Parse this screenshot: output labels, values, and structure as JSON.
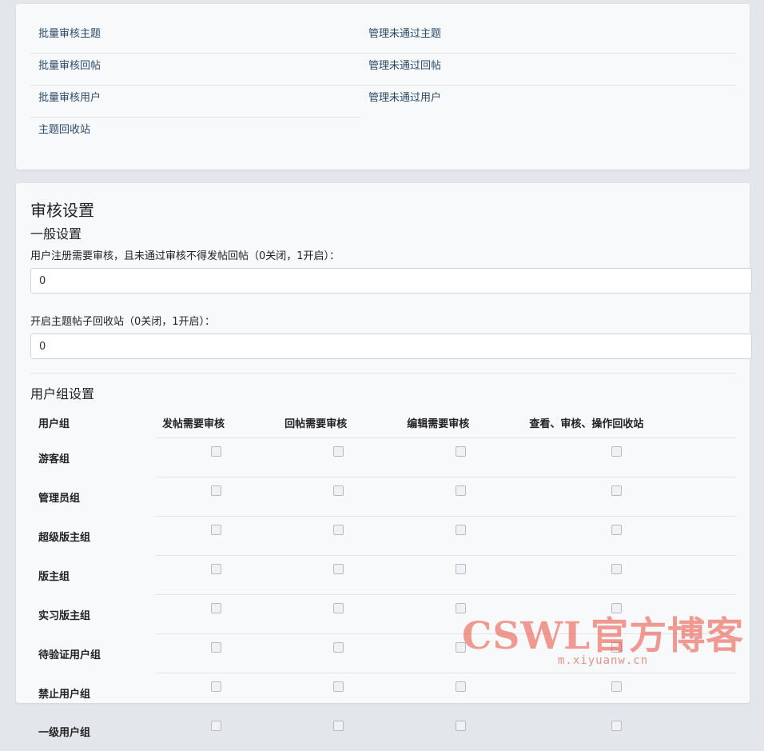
{
  "links": {
    "left": [
      "批量审核主题",
      "批量审核回帖",
      "批量审核用户",
      "主题回收站"
    ],
    "right": [
      "管理未通过主题",
      "管理未通过回帖",
      "管理未通过用户"
    ]
  },
  "settings": {
    "title": "审核设置",
    "general_title": "一般设置",
    "register_label": "用户注册需要审核，且未通过审核不得发帖回帖（0关闭，1开启）：",
    "register_value": "0",
    "recycle_label": "开启主题帖子回收站（0关闭，1开启）：",
    "recycle_value": "0"
  },
  "group_settings": {
    "title": "用户组设置",
    "columns": [
      "用户组",
      "发帖需要审核",
      "回帖需要审核",
      "编辑需要审核",
      "查看、审核、操作回收站"
    ],
    "rows": [
      {
        "name": "游客组",
        "checks": [
          false,
          false,
          false,
          false
        ]
      },
      {
        "name": "管理员组",
        "checks": [
          false,
          false,
          false,
          false
        ]
      },
      {
        "name": "超级版主组",
        "checks": [
          false,
          false,
          false,
          false
        ]
      },
      {
        "name": "版主组",
        "checks": [
          false,
          false,
          false,
          false
        ]
      },
      {
        "name": "实习版主组",
        "checks": [
          false,
          false,
          false,
          false
        ]
      },
      {
        "name": "待验证用户组",
        "checks": [
          false,
          false,
          false,
          false
        ]
      },
      {
        "name": "禁止用户组",
        "checks": [
          false,
          false,
          false,
          false
        ]
      },
      {
        "name": "一级用户组",
        "checks": [
          false,
          false,
          false,
          false
        ]
      }
    ]
  },
  "watermark": {
    "text": "CSWL官方博客",
    "url": "m.xiyuanw.cn"
  }
}
